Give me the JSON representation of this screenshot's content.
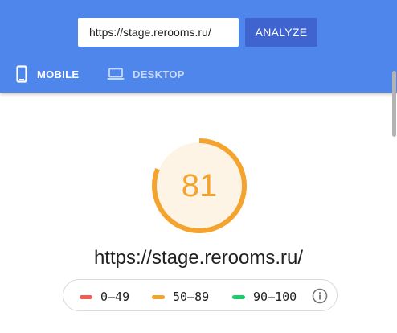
{
  "header": {
    "url_value": "https://stage.rerooms.ru/",
    "analyze_label": "ANALYZE",
    "tabs": [
      {
        "label": "MOBILE",
        "icon": "smartphone-icon",
        "active": true
      },
      {
        "label": "DESKTOP",
        "icon": "laptop-icon",
        "active": false
      }
    ]
  },
  "report": {
    "score": "81",
    "score_fraction": 0.81,
    "analyzed_url": "https://stage.rerooms.ru/"
  },
  "legend": {
    "items": [
      {
        "label": "0–49",
        "color": "#f25c54"
      },
      {
        "label": "50–89",
        "color": "#f4a32e"
      },
      {
        "label": "90–100",
        "color": "#19cc6c"
      }
    ],
    "info_icon": "info-icon"
  },
  "colors": {
    "header_bg": "#4f86ec",
    "analyze_bg": "#3f64cf",
    "score_color": "#f4a32e",
    "score_fill": "#fdf4e6"
  }
}
